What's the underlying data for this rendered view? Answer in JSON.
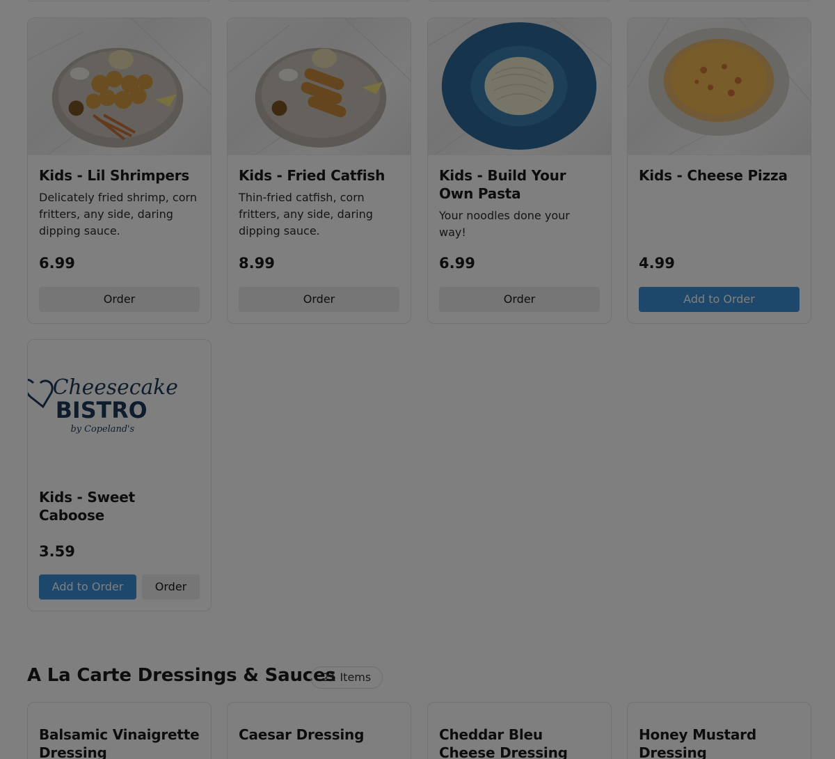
{
  "colors": {
    "overlay": "rgba(0,0,0,0.5)",
    "add_button": "#3b8fd6",
    "order_button": "#ececec",
    "brand_navy": "#1d3a5a"
  },
  "items": [
    {
      "title": "Kids - Lil Shrimpers",
      "description": "Delicately fried shrimp, corn fritters, any side, daring dipping sauce.",
      "price": "6.99",
      "order_label": "Order",
      "image": "fried-shrimp-plate"
    },
    {
      "title": "Kids - Fried Catfish",
      "description": "Thin-fried catfish, corn fritters, any side, daring dipping sauce.",
      "price": "8.99",
      "order_label": "Order",
      "image": "fried-catfish-plate"
    },
    {
      "title": "Kids - Build Your Own Pasta",
      "description": "Your noodles done your way!",
      "price": "6.99",
      "order_label": "Order",
      "image": "pasta-bowl"
    },
    {
      "title": "Kids - Cheese Pizza",
      "description": "",
      "price": "4.99",
      "add_label": "Add to Order",
      "image": "cheese-pizza"
    },
    {
      "title": "Kids - Sweet Caboose",
      "description": "",
      "price": "3.59",
      "add_label": "Add to Order",
      "order_label": "Order",
      "image": "cheesecake-bistro-logo",
      "logo": {
        "line1": "Cheesecake",
        "line2": "BISTRO",
        "line3": "by Copeland's"
      }
    }
  ],
  "section": {
    "title": "A La Carte Dressings & Sauces",
    "count": "21 Items",
    "items": [
      {
        "title": "Balsamic Vinaigrette Dressing"
      },
      {
        "title": "Caesar Dressing"
      },
      {
        "title": "Cheddar Bleu Cheese Dressing"
      },
      {
        "title": "Honey Mustard Dressing"
      }
    ]
  }
}
